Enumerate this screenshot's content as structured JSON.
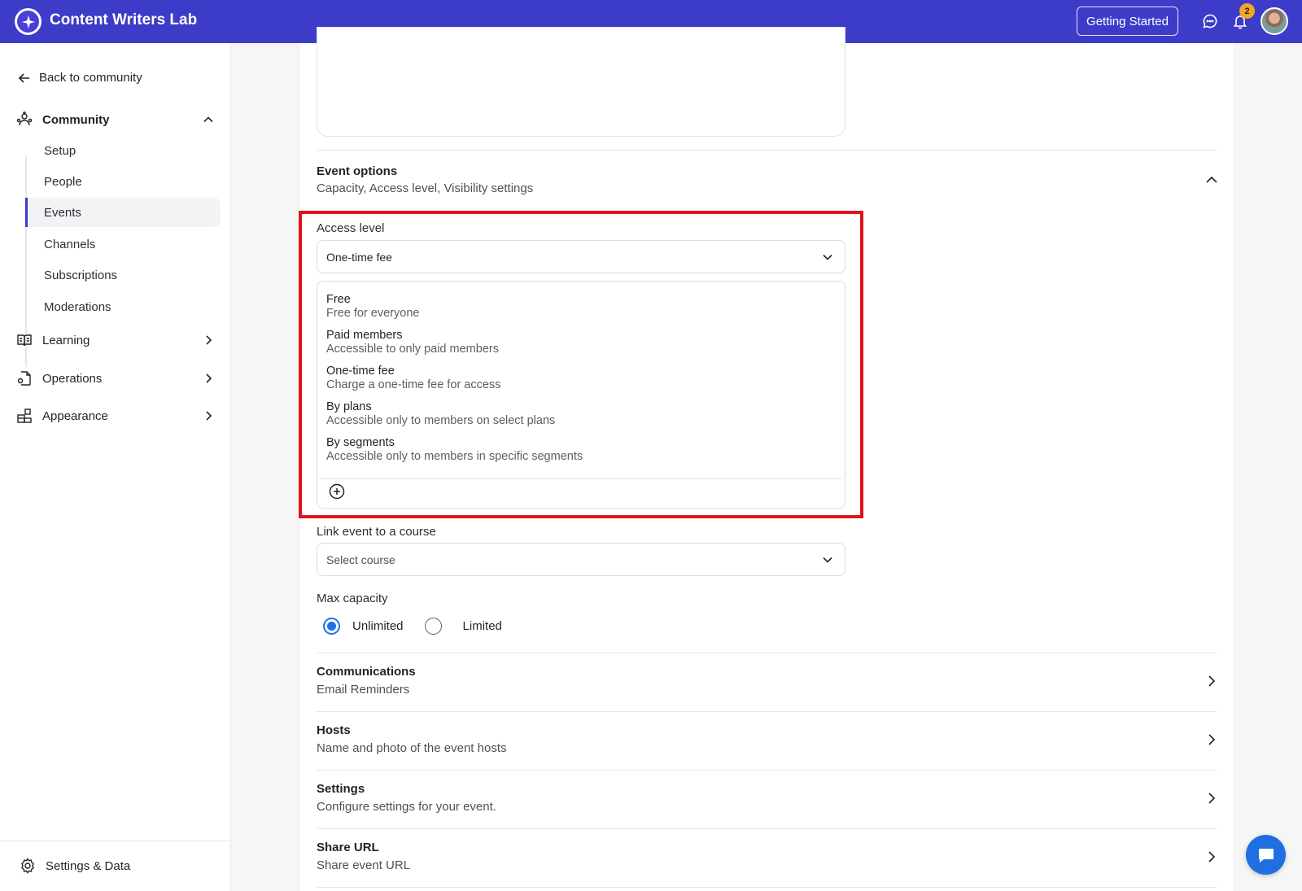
{
  "app": {
    "name": "Content Writers Lab"
  },
  "header": {
    "getting_started_label": "Getting Started",
    "notification_count": "2"
  },
  "sidebar": {
    "back_label": "Back to community",
    "community_label": "Community",
    "community_items": [
      "Setup",
      "People",
      "Events",
      "Channels",
      "Subscriptions",
      "Moderations"
    ],
    "active_item": "Events",
    "learning_label": "Learning",
    "operations_label": "Operations",
    "appearance_label": "Appearance",
    "settings_label": "Settings & Data"
  },
  "event_options": {
    "title": "Event options",
    "subtitle": "Capacity, Access level, Visibility settings",
    "access_level_label": "Access level",
    "access_level_value": "One-time fee",
    "access_options": [
      {
        "title": "Free",
        "desc": "Free for everyone"
      },
      {
        "title": "Paid members",
        "desc": "Accessible to only paid members"
      },
      {
        "title": "One-time fee",
        "desc": "Charge a one-time fee for access"
      },
      {
        "title": "By plans",
        "desc": "Accessible only to members on select plans"
      },
      {
        "title": "By segments",
        "desc": "Accessible only to members in specific segments"
      }
    ],
    "course_label": "Link event to a course",
    "course_placeholder": "Select course",
    "capacity_label": "Max capacity",
    "capacity_options": [
      "Unlimited",
      "Limited"
    ],
    "capacity_selected": "Unlimited"
  },
  "sections": [
    {
      "title": "Communications",
      "subtitle": "Email Reminders"
    },
    {
      "title": "Hosts",
      "subtitle": "Name and photo of the event hosts"
    },
    {
      "title": "Settings",
      "subtitle": "Configure settings for your event."
    },
    {
      "title": "Share URL",
      "subtitle": "Share event URL"
    }
  ],
  "colors": {
    "brand": "#3d3cc9",
    "highlight": "#e0141b",
    "accent": "#1a73e8"
  }
}
